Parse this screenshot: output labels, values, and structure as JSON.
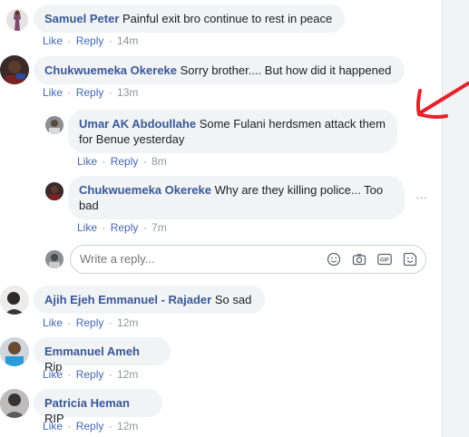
{
  "comments": [
    {
      "author": "Samuel Peter",
      "text": "Painful exit bro continue to rest in peace",
      "like": "Like",
      "reply": "Reply",
      "time": "14m"
    },
    {
      "author": "Chukwuemeka Okereke",
      "text": "Sorry brother.... But how did it happened",
      "like": "Like",
      "reply": "Reply",
      "time": "13m"
    },
    {
      "author": "Umar AK Abdoullahe",
      "text": "Some Fulani herdsmen attack them for Benue yesterday",
      "like": "Like",
      "reply": "Reply",
      "time": "8m"
    },
    {
      "author": "Chukwuemeka Okereke",
      "text": "Why are they killing police... Too bad",
      "like": "Like",
      "reply": "Reply",
      "time": "7m"
    },
    {
      "author": "Ajih Ejeh Emmanuel - Rajader",
      "text": "So sad",
      "like": "Like",
      "reply": "Reply",
      "time": "12m"
    },
    {
      "author": "Emmanuel Ameh",
      "text": "Rip",
      "like": "Like",
      "reply": "Reply",
      "time": "12m"
    },
    {
      "author": "Patricia Heman",
      "text": "RIP",
      "like": "Like",
      "reply": "Reply",
      "time": "12m"
    }
  ],
  "reply_box": {
    "placeholder": "Write a reply..."
  },
  "icons": {
    "emoji": "emoji-icon",
    "camera": "camera-icon",
    "gif": "gif-icon",
    "sticker": "sticker-icon",
    "more": "more-options-icon",
    "arrow": "red-arrow-annotation"
  },
  "colors": {
    "author": "#385898",
    "link": "#4267b2",
    "meta": "#90949c",
    "bubble": "#f2f3f5",
    "annotation": "#e8202a"
  }
}
